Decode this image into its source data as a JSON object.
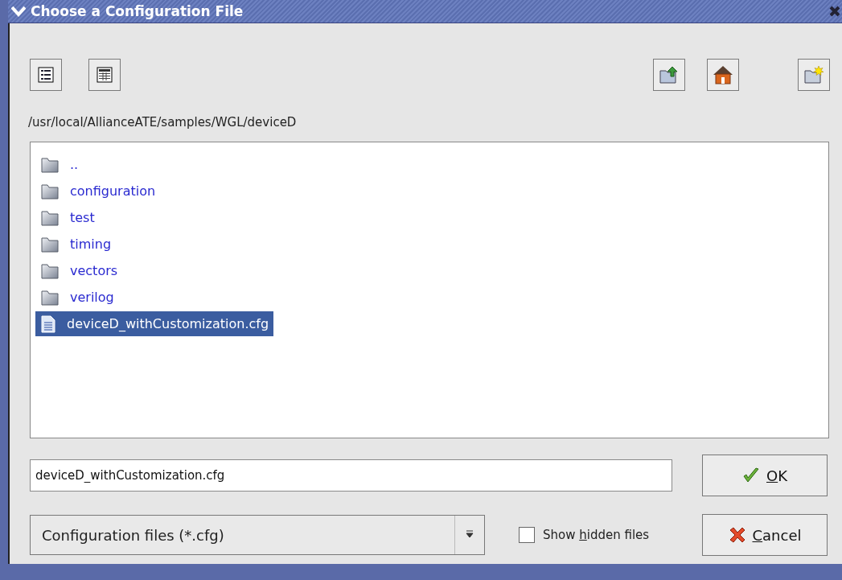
{
  "window": {
    "title": "Choose a Configuration File"
  },
  "path": "/usr/local/AllianceATE/samples/WGL/deviceD",
  "files": [
    {
      "name": "..",
      "kind": "folder",
      "selected": false
    },
    {
      "name": "configuration",
      "kind": "folder",
      "selected": false
    },
    {
      "name": "test",
      "kind": "folder",
      "selected": false
    },
    {
      "name": "timing",
      "kind": "folder",
      "selected": false
    },
    {
      "name": "vectors",
      "kind": "folder",
      "selected": false
    },
    {
      "name": "verilog",
      "kind": "folder",
      "selected": false
    },
    {
      "name": "deviceD_withCustomization.cfg",
      "kind": "file",
      "selected": true
    }
  ],
  "filename": {
    "value": "deviceD_withCustomization.cfg"
  },
  "filter": {
    "value": "Configuration files (*.cfg)"
  },
  "show_hidden": {
    "label": {
      "pre": "Show ",
      "key": "h",
      "post": "idden files"
    },
    "checked": false
  },
  "buttons": [
    {
      "kind": "ok",
      "label": {
        "key": "O",
        "post": "K"
      }
    },
    {
      "kind": "cancel",
      "label": {
        "key": "C",
        "post": "ancel"
      }
    }
  ]
}
